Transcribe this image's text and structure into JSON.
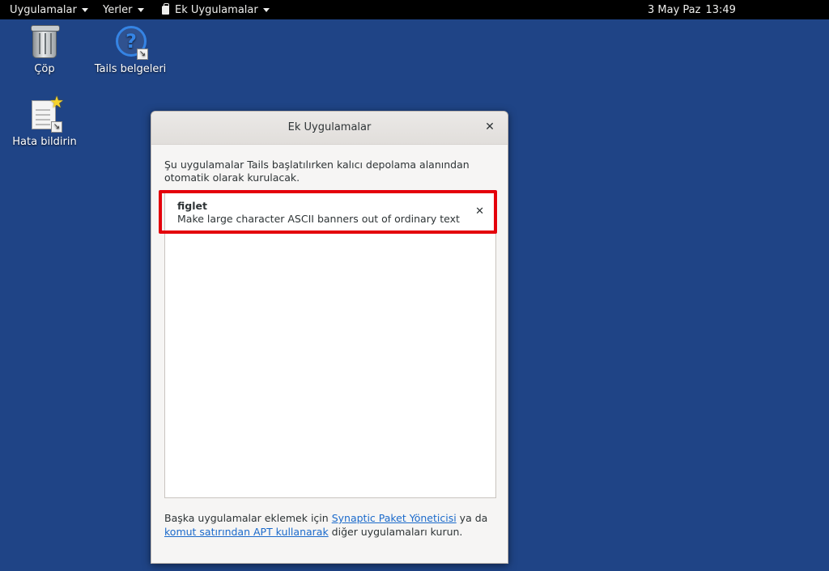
{
  "topbar": {
    "applications": "Uygulamalar",
    "places": "Yerler",
    "extra_apps": "Ek Uygulamalar",
    "date": "3 May Paz",
    "time": "13:49"
  },
  "desktop": {
    "trash": {
      "label": "Çöp",
      "icon": "trash-icon"
    },
    "docs": {
      "label": "Tails belgeleri",
      "icon": "help-icon"
    },
    "bug": {
      "label": "Hata bildirin",
      "icon": "bug-report-icon"
    }
  },
  "dialog": {
    "title": "Ek Uygulamalar",
    "intro": "Şu uygulamalar Tails başlatılırken kalıcı depolama alanından otomatik olarak kurulacak.",
    "apps": [
      {
        "name": "figlet",
        "description": "Make large character ASCII banners out of ordinary text"
      }
    ],
    "footer": {
      "part1": "Başka uygulamalar eklemek için ",
      "link1": "Synaptic Paket Yöneticisi",
      "part2": " ya da ",
      "link2": "komut satırından APT kullanarak",
      "part3": " diğer uygulamaları kurun."
    }
  },
  "colors": {
    "desktop": "#1f4486",
    "highlight": "#e4000b",
    "link": "#1b6acb"
  }
}
